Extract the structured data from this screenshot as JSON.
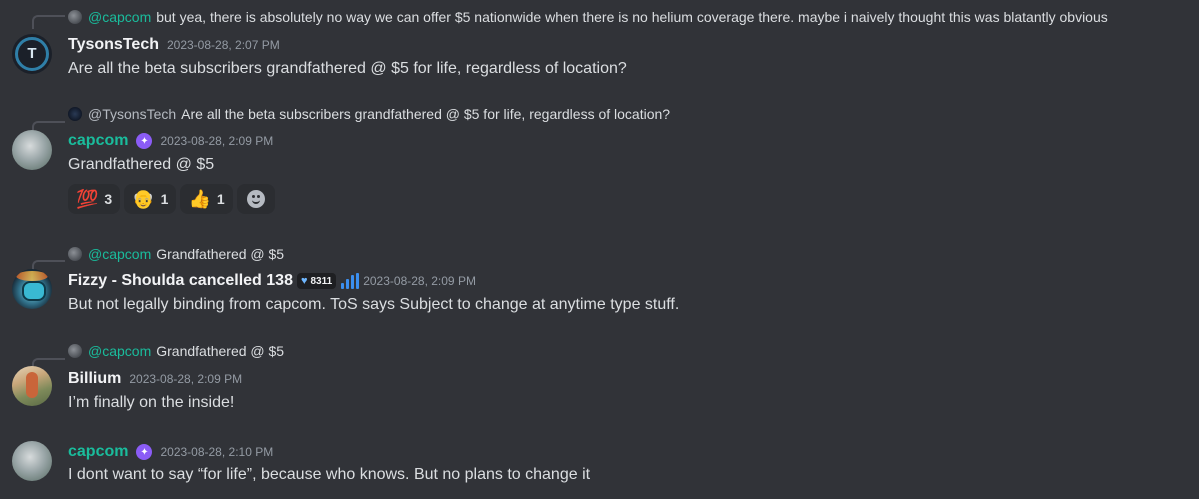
{
  "messages": [
    {
      "reply": {
        "mention": "@capcom",
        "text": "but yea, there is absolutely no way we can offer $5 nationwide when there is no helium coverage there. maybe i naively thought this was blatantly obvious"
      },
      "author": "TysonsTech",
      "timestamp": "2023-08-28, 2:07 PM",
      "content": "Are all the beta subscribers grandfathered @ $5 for life, regardless of location?"
    },
    {
      "reply": {
        "mention": "@TysonsTech",
        "text": "Are all the beta subscribers grandfathered @ $5 for life, regardless of location?"
      },
      "author": "capcom",
      "timestamp": "2023-08-28, 2:09 PM",
      "content": "Grandfathered @ $5",
      "reactions": [
        {
          "emoji": "💯",
          "icon": "hundred-points-icon",
          "count": "3"
        },
        {
          "emoji": "👴",
          "icon": "old-man-icon",
          "count": "1"
        },
        {
          "emoji": "👍",
          "icon": "thumbs-up-icon",
          "count": "1"
        }
      ]
    },
    {
      "reply": {
        "mention": "@capcom",
        "text": "Grandfathered @ $5"
      },
      "author": "Fizzy - Shoulda cancelled 138",
      "role_tag": "8311",
      "timestamp": "2023-08-28, 2:09 PM",
      "content": "But not legally binding from capcom.  ToS says Subject to change at anytime type stuff."
    },
    {
      "reply": {
        "mention": "@capcom",
        "text": "Grandfathered @ $5"
      },
      "author": "Billium",
      "timestamp": "2023-08-28, 2:09 PM",
      "content": "I’m finally on the inside!"
    },
    {
      "author": "capcom",
      "timestamp": "2023-08-28, 2:10 PM",
      "content": "I dont want to say “for life”, because who knows. But no plans to change it"
    }
  ],
  "colors": {
    "background": "#313338",
    "teal_name": "#1abc9c",
    "nitro_badge": "#8b5cf6"
  }
}
